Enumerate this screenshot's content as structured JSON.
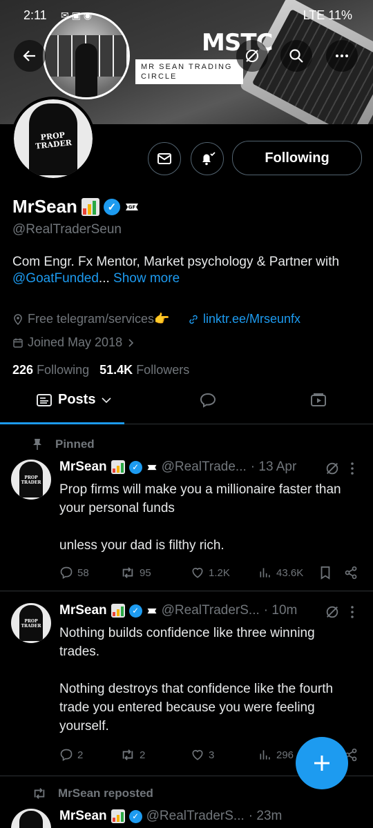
{
  "status_bar": {
    "time": "2:11",
    "icons": "✉ ▣ ◉",
    "battery": "LTE  11%"
  },
  "banner": {
    "logo": "MSTC",
    "subtitle": "MR SEAN TRADING CIRCLE"
  },
  "avatar_text": "PROP TRADER",
  "profile": {
    "name": "MrSean",
    "handle": "@RealTraderSeun",
    "bio_text": "Com Engr. Fx Mentor, Market psychology & Partner with ",
    "bio_mention": "@GoatFunded",
    "bio_ellipsis": "...",
    "bio_show_more": "Show more",
    "location": "Free telegram/services👉",
    "website": "linktr.ee/Mrseunfx",
    "joined": "Joined May 2018",
    "following_count": "226",
    "following_label": "Following",
    "followers_count": "51.4K",
    "followers_label": "Followers",
    "follow_button": "Following"
  },
  "tabs": {
    "posts": "Posts"
  },
  "pinned_label": "Pinned",
  "tweets": [
    {
      "name": "MrSean",
      "handle": "@RealTrade...",
      "time": "· 13 Apr",
      "text": "Prop firms will make you a millionaire faster than your personal funds\n\nunless your dad is filthy rich.",
      "replies": "58",
      "reposts": "95",
      "likes": "1.2K",
      "views": "43.6K"
    },
    {
      "name": "MrSean",
      "handle": "@RealTraderS...",
      "time": "· 10m",
      "text": "Nothing builds confidence like three winning trades.\n\nNothing destroys that confidence like the fourth trade you entered because you were feeling yourself.",
      "replies": "2",
      "reposts": "2",
      "likes": "3",
      "views": "296"
    },
    {
      "name": "MrSean",
      "handle": "@RealTraderS...",
      "time": "· 23m"
    }
  ],
  "repost_label": "MrSean reposted",
  "colors": {
    "accent": "#1d9bf0",
    "bg": "#000000",
    "muted": "#71767b"
  }
}
